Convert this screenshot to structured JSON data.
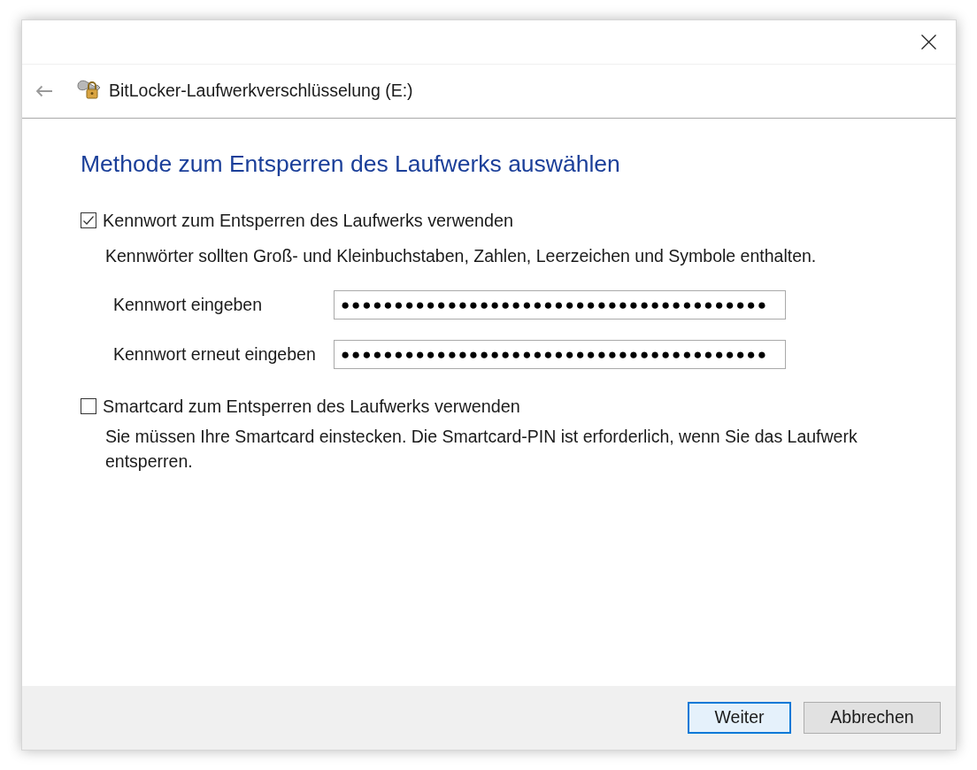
{
  "header": {
    "title": "BitLocker-Laufwerkverschlüsselung (E:)"
  },
  "heading": "Methode zum Entsperren des Laufwerks auswählen",
  "options": [
    {
      "label": "Kennwort zum Entsperren des Laufwerks verwenden",
      "checked": true,
      "description": "Kennwörter sollten Groß- und Kleinbuchstaben, Zahlen, Leerzeichen und Symbole enthalten.",
      "fields": [
        {
          "label": "Kennwort eingeben",
          "value": "●●●●●●●●●●●●●●●●●●●●●●●●●●●●●●●●●●●●●●●●"
        },
        {
          "label": "Kennwort erneut eingeben",
          "value": "●●●●●●●●●●●●●●●●●●●●●●●●●●●●●●●●●●●●●●●●"
        }
      ]
    },
    {
      "label": "Smartcard zum Entsperren des Laufwerks verwenden",
      "checked": false,
      "description": "Sie müssen Ihre Smartcard einstecken. Die Smartcard-PIN ist erforderlich, wenn Sie das Laufwerk entsperren."
    }
  ],
  "buttons": [
    {
      "label": "Weiter",
      "selected": true
    },
    {
      "label": "Abbrechen",
      "selected": false
    }
  ]
}
